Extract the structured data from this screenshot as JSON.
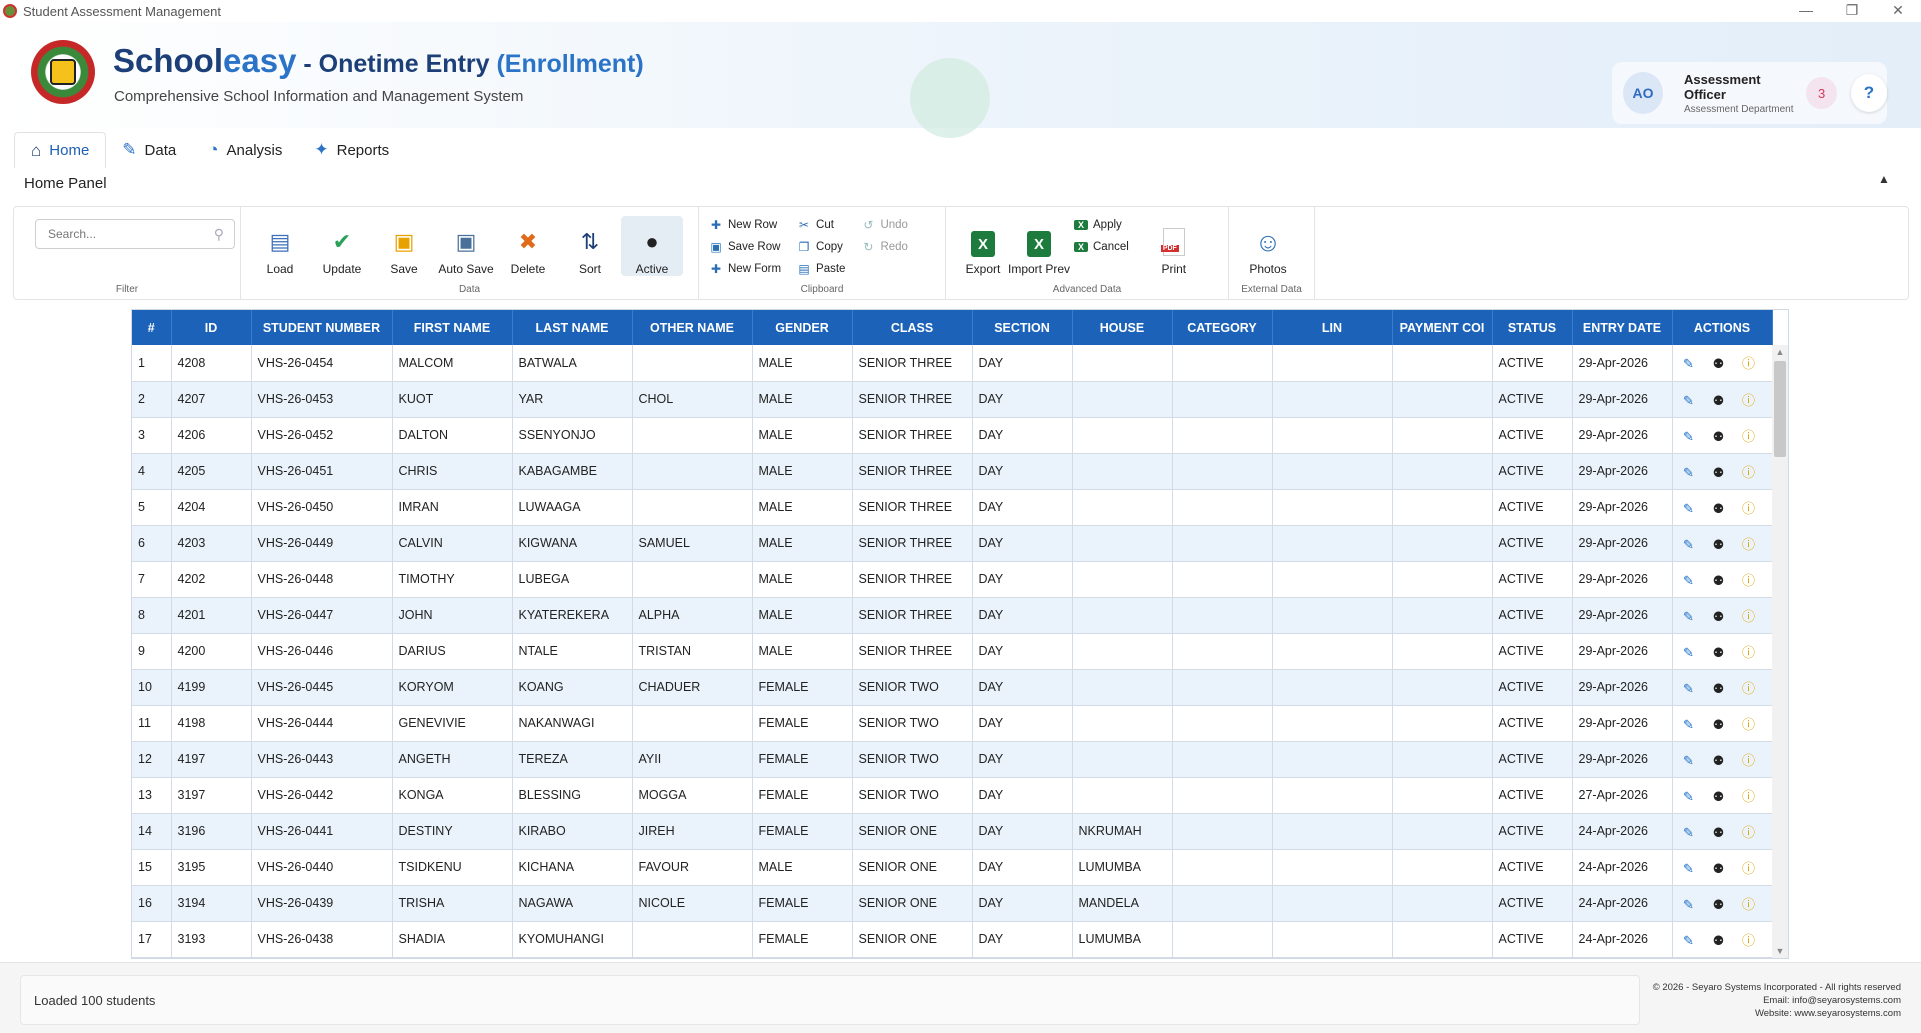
{
  "window": {
    "title": "Student Assessment Management",
    "controls": [
      "—",
      "❐",
      "✕"
    ]
  },
  "header": {
    "brand_part1": "School",
    "brand_part2": "easy",
    "brand_part3": " - Onetime Entry ",
    "brand_part4": "(Enrollment)",
    "subtitle": "Comprehensive School Information and Management System",
    "user": {
      "initials": "AO",
      "name": "Assessment Officer",
      "department": "Assessment Department",
      "notifications": "3",
      "help": "?"
    }
  },
  "tabs": [
    {
      "label": "Home",
      "icon": "home-icon",
      "glyph": "⌂",
      "active": true
    },
    {
      "label": "Data",
      "icon": "edit-icon",
      "glyph": "✎"
    },
    {
      "label": "Analysis",
      "icon": "analysis-icon",
      "glyph": "◔"
    },
    {
      "label": "Reports",
      "icon": "reports-icon",
      "glyph": "✦"
    }
  ],
  "panel_title": "Home Panel",
  "ribbon": {
    "filter": {
      "placeholder": "Search...",
      "label": "Filter"
    },
    "data": {
      "label": "Data",
      "buttons": [
        {
          "label": "Load",
          "icon": "load-icon",
          "glyph": "▤",
          "color": "#3b6fb6"
        },
        {
          "label": "Update",
          "icon": "update-icon",
          "glyph": "✔",
          "color": "#2aa05a"
        },
        {
          "label": "Save",
          "icon": "save-icon",
          "glyph": "▣",
          "color": "#e8a200"
        },
        {
          "label": "Auto Save",
          "icon": "autosave-icon",
          "glyph": "▣",
          "color": "#4a6f9a"
        },
        {
          "label": "Delete",
          "icon": "delete-icon",
          "glyph": "✖",
          "color": "#e06a1a"
        },
        {
          "label": "Sort",
          "icon": "sort-icon",
          "glyph": "⇅",
          "color": "#1d3f77"
        },
        {
          "label": "Active",
          "icon": "active-user-icon",
          "glyph": "●",
          "color": "#222"
        }
      ]
    },
    "clipboard": {
      "label": "Clipboard",
      "col1": [
        {
          "label": "New Row",
          "icon": "new-row-icon",
          "glyph": "✚"
        },
        {
          "label": "Save Row",
          "icon": "save-row-icon",
          "glyph": "▣"
        },
        {
          "label": "New Form",
          "icon": "new-form-icon",
          "glyph": "✚"
        }
      ],
      "col2": [
        {
          "label": "Cut",
          "icon": "cut-icon",
          "glyph": "✂"
        },
        {
          "label": "Copy",
          "icon": "copy-icon",
          "glyph": "❐"
        },
        {
          "label": "Paste",
          "icon": "paste-icon",
          "glyph": "▤"
        }
      ],
      "col3": [
        {
          "label": "Undo",
          "icon": "undo-icon",
          "glyph": "↺",
          "disabled": true
        },
        {
          "label": "Redo",
          "icon": "redo-icon",
          "glyph": "↻",
          "disabled": true
        }
      ]
    },
    "advanced": {
      "label": "Advanced Data",
      "big": [
        {
          "label": "Export",
          "icon": "excel-export-icon",
          "glyph": "X",
          "color": "#1e7b3e"
        },
        {
          "label": "Import Prev",
          "icon": "excel-import-icon",
          "glyph": "X",
          "color": "#1e7b3e"
        }
      ],
      "small": [
        {
          "label": "Apply",
          "icon": "apply-icon",
          "glyph": "X"
        },
        {
          "label": "Cancel",
          "icon": "cancel-icon",
          "glyph": "X"
        }
      ],
      "print": {
        "label": "Print",
        "icon": "pdf-print-icon",
        "glyph": "PDF",
        "color": "#d32f2f"
      }
    },
    "external": {
      "label": "External Data",
      "photos": {
        "label": "Photos",
        "icon": "photos-person-icon",
        "glyph": "☺",
        "color": "#2a6fb5"
      }
    }
  },
  "grid": {
    "columns": [
      "#",
      "ID",
      "STUDENT NUMBER",
      "FIRST NAME",
      "LAST NAME",
      "OTHER NAME",
      "GENDER",
      "CLASS",
      "SECTION",
      "HOUSE",
      "CATEGORY",
      "LIN",
      "PAYMENT COI",
      "STATUS",
      "ENTRY DATE",
      "ACTIONS"
    ],
    "rows": [
      [
        "1",
        "4208",
        "VHS-26-0454",
        "MALCOM",
        "BATWALA",
        "",
        "MALE",
        "SENIOR THREE",
        "DAY",
        "",
        "",
        "",
        "",
        "ACTIVE",
        "29-Apr-2026"
      ],
      [
        "2",
        "4207",
        "VHS-26-0453",
        "KUOT",
        "YAR",
        "CHOL",
        "MALE",
        "SENIOR THREE",
        "DAY",
        "",
        "",
        "",
        "",
        "ACTIVE",
        "29-Apr-2026"
      ],
      [
        "3",
        "4206",
        "VHS-26-0452",
        "DALTON",
        "SSENYONJO",
        "",
        "MALE",
        "SENIOR THREE",
        "DAY",
        "",
        "",
        "",
        "",
        "ACTIVE",
        "29-Apr-2026"
      ],
      [
        "4",
        "4205",
        "VHS-26-0451",
        "CHRIS",
        "KABAGAMBE",
        "",
        "MALE",
        "SENIOR THREE",
        "DAY",
        "",
        "",
        "",
        "",
        "ACTIVE",
        "29-Apr-2026"
      ],
      [
        "5",
        "4204",
        "VHS-26-0450",
        "IMRAN",
        "LUWAAGA",
        "",
        "MALE",
        "SENIOR THREE",
        "DAY",
        "",
        "",
        "",
        "",
        "ACTIVE",
        "29-Apr-2026"
      ],
      [
        "6",
        "4203",
        "VHS-26-0449",
        "CALVIN",
        "KIGWANA",
        "SAMUEL",
        "MALE",
        "SENIOR THREE",
        "DAY",
        "",
        "",
        "",
        "",
        "ACTIVE",
        "29-Apr-2026"
      ],
      [
        "7",
        "4202",
        "VHS-26-0448",
        "TIMOTHY",
        "LUBEGA",
        "",
        "MALE",
        "SENIOR THREE",
        "DAY",
        "",
        "",
        "",
        "",
        "ACTIVE",
        "29-Apr-2026"
      ],
      [
        "8",
        "4201",
        "VHS-26-0447",
        "JOHN",
        "KYATEREKERA",
        "ALPHA",
        "MALE",
        "SENIOR THREE",
        "DAY",
        "",
        "",
        "",
        "",
        "ACTIVE",
        "29-Apr-2026"
      ],
      [
        "9",
        "4200",
        "VHS-26-0446",
        "DARIUS",
        "NTALE",
        "TRISTAN",
        "MALE",
        "SENIOR THREE",
        "DAY",
        "",
        "",
        "",
        "",
        "ACTIVE",
        "29-Apr-2026"
      ],
      [
        "10",
        "4199",
        "VHS-26-0445",
        "KORYOM",
        "KOANG",
        "CHADUER",
        "FEMALE",
        "SENIOR TWO",
        "DAY",
        "",
        "",
        "",
        "",
        "ACTIVE",
        "29-Apr-2026"
      ],
      [
        "11",
        "4198",
        "VHS-26-0444",
        "GENEVIVIE",
        "NAKANWAGI",
        "",
        "FEMALE",
        "SENIOR TWO",
        "DAY",
        "",
        "",
        "",
        "",
        "ACTIVE",
        "29-Apr-2026"
      ],
      [
        "12",
        "4197",
        "VHS-26-0443",
        "ANGETH",
        "TEREZA",
        "AYII",
        "FEMALE",
        "SENIOR TWO",
        "DAY",
        "",
        "",
        "",
        "",
        "ACTIVE",
        "29-Apr-2026"
      ],
      [
        "13",
        "3197",
        "VHS-26-0442",
        "KONGA",
        "BLESSING",
        "MOGGA",
        "FEMALE",
        "SENIOR TWO",
        "DAY",
        "",
        "",
        "",
        "",
        "ACTIVE",
        "27-Apr-2026"
      ],
      [
        "14",
        "3196",
        "VHS-26-0441",
        "DESTINY",
        "KIRABO",
        "JIREH",
        "FEMALE",
        "SENIOR ONE",
        "DAY",
        "NKRUMAH",
        "",
        "",
        "",
        "ACTIVE",
        "24-Apr-2026"
      ],
      [
        "15",
        "3195",
        "VHS-26-0440",
        "TSIDKENU",
        "KICHANA",
        "FAVOUR",
        "MALE",
        "SENIOR ONE",
        "DAY",
        "LUMUMBA",
        "",
        "",
        "",
        "ACTIVE",
        "24-Apr-2026"
      ],
      [
        "16",
        "3194",
        "VHS-26-0439",
        "TRISHA",
        "NAGAWA",
        "NICOLE",
        "FEMALE",
        "SENIOR ONE",
        "DAY",
        "MANDELA",
        "",
        "",
        "",
        "ACTIVE",
        "24-Apr-2026"
      ],
      [
        "17",
        "3193",
        "VHS-26-0438",
        "SHADIA",
        "KYOMUHANGI",
        "",
        "FEMALE",
        "SENIOR ONE",
        "DAY",
        "LUMUMBA",
        "",
        "",
        "",
        "ACTIVE",
        "24-Apr-2026"
      ]
    ],
    "actions": [
      {
        "name": "edit-icon",
        "glyph": "✎"
      },
      {
        "name": "user-remove-icon",
        "glyph": "⚉"
      },
      {
        "name": "info-icon",
        "glyph": "ⓘ"
      }
    ]
  },
  "status": {
    "message": "Loaded 100 students",
    "copyright": "© 2026 - Seyaro Systems Incorporated - All rights reserved",
    "email": "Email: info@seyarosystems.com",
    "website": "Website: www.seyarosystems.com"
  },
  "colors": {
    "accent": "#1b62b8",
    "brand_dark": "#1d3f77",
    "brand_light": "#2b73c7",
    "row_alt": "#eaf3fb"
  }
}
